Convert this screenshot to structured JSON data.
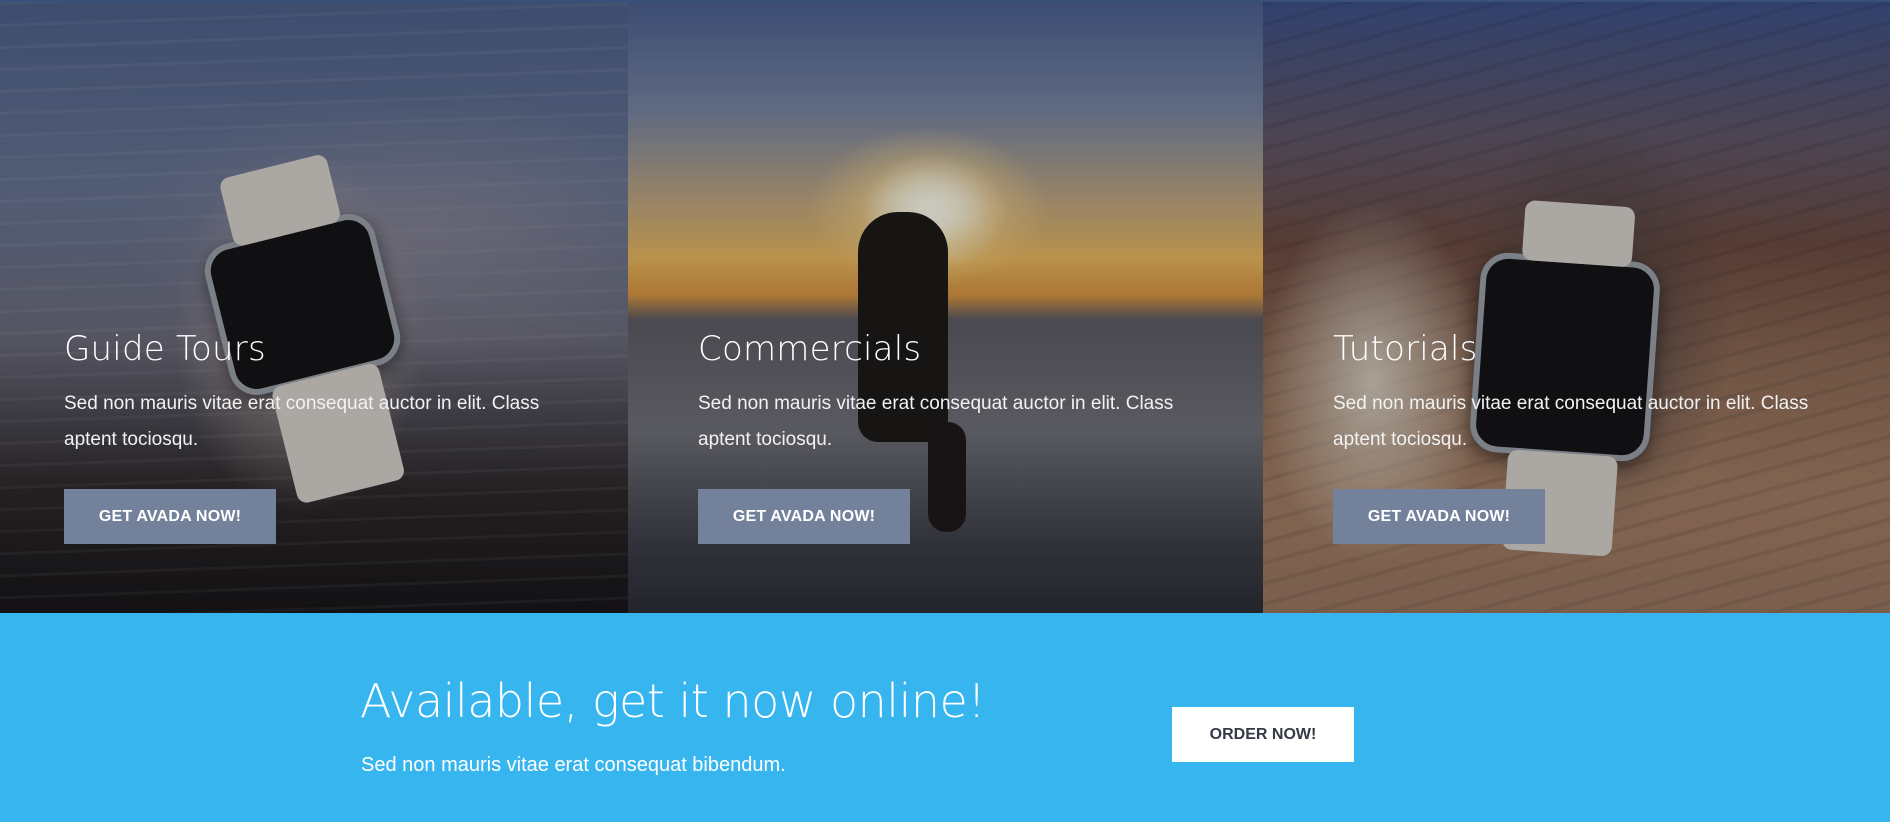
{
  "panels": [
    {
      "title": "Guide Tours",
      "text": "Sed non mauris vitae erat consequat auctor in elit. Class aptent tociosqu.",
      "button_label": "GET AVADA NOW!"
    },
    {
      "title": "Commercials",
      "text": "Sed non mauris vitae erat consequat auctor in elit. Class aptent tociosqu.",
      "button_label": "GET AVADA NOW!"
    },
    {
      "title": "Tutorials",
      "text": "Sed non mauris vitae erat consequat auctor in elit. Class aptent tociosqu.",
      "button_label": "GET AVADA NOW!"
    }
  ],
  "cta": {
    "title": "Available, get it now online!",
    "subtitle": "Sed non mauris vitae erat consequat bibendum.",
    "button_label": "ORDER NOW!"
  },
  "colors": {
    "cta_background": "#37b5ee",
    "panel_button": "#74819b",
    "cta_button": "#ffffff"
  }
}
